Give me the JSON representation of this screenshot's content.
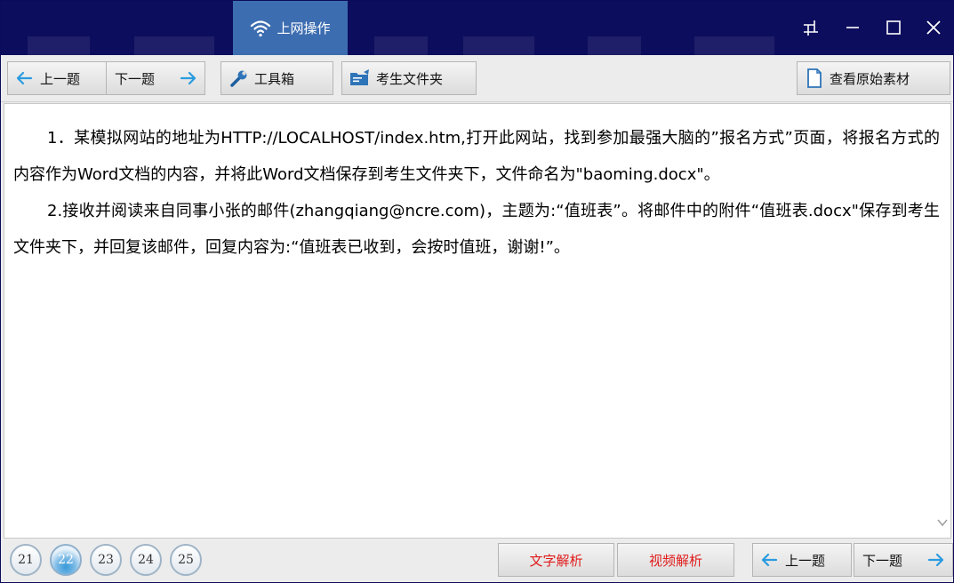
{
  "titlebar": {
    "tab_label": "上网操作"
  },
  "toolbar": {
    "prev_label": "上一题",
    "next_label": "下一题",
    "toolbox_label": "工具箱",
    "folder_label": "考生文件夹",
    "source_label": "查看原始素材"
  },
  "content": {
    "para1": "1．某模拟网站的地址为HTTP://LOCALHOST/index.htm,打开此网站，找到参加最强大脑的”报名方式”页面，将报名方式的内容作为Word文档的内容，并将此Word文档保存到考生文件夹下，文件命名为\"baoming.docx\"。",
    "para2": "2.接收并阅读来自同事小张的邮件(zhangqiang@ncre.com)，主题为:“值班表”。将邮件中的附件“值班表.docx\"保存到考生文件夹下，并回复该邮件，回复内容为:“值班表已收到，会按时值班，谢谢!”。"
  },
  "footer": {
    "numbers": [
      "21",
      "22",
      "23",
      "24",
      "25"
    ],
    "active_number": "22",
    "text_analysis_label": "文字解析",
    "video_analysis_label": "视频解析",
    "prev_label": "上一题",
    "next_label": "下一题"
  },
  "colors": {
    "titlebar_bg": "#0d0d5e",
    "active_tab": "#3d6db1",
    "arrow_blue": "#2a9be0",
    "analysis_red": "#e01b1b"
  },
  "icons": [
    "wifi-icon",
    "restore-icon",
    "minimize-icon",
    "maximize-icon",
    "close-icon",
    "arrow-left-icon",
    "arrow-right-icon",
    "wrench-icon",
    "folder-icon",
    "document-icon"
  ]
}
